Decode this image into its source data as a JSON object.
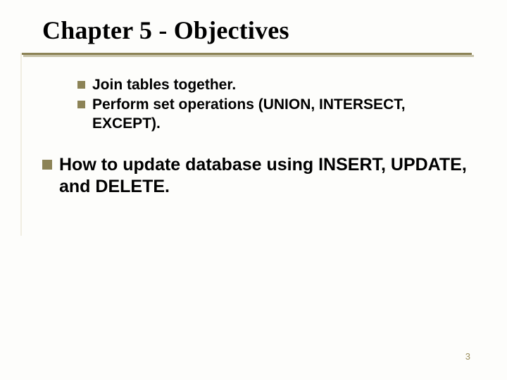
{
  "title": "Chapter 5 - Objectives",
  "sub_bullets": [
    "Join tables together.",
    "Perform set operations (UNION, INTERSECT, EXCEPT)."
  ],
  "main_bullet": "How to update database using INSERT, UPDATE, and DELETE.",
  "page_number": "3"
}
